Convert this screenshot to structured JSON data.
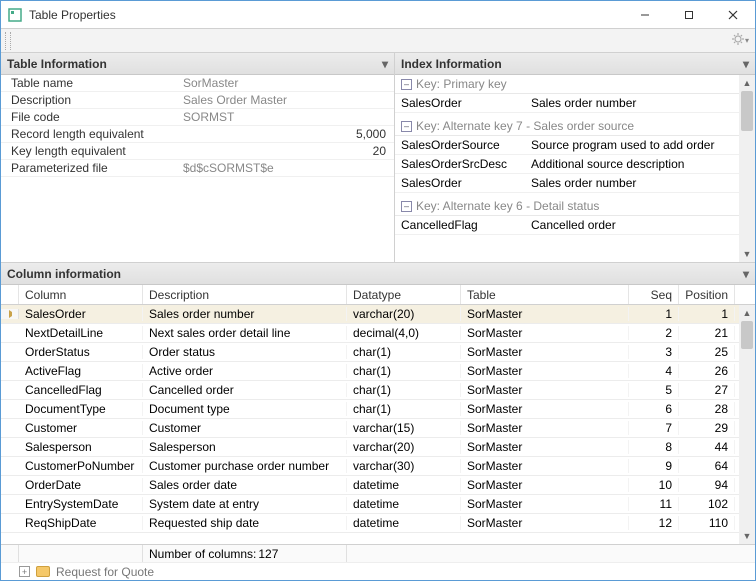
{
  "window": {
    "title": "Table Properties"
  },
  "panels": {
    "tableInfo": "Table Information",
    "indexInfo": "Index Information",
    "columnInfo": "Column information"
  },
  "tableInfo": {
    "rows": [
      {
        "label": "Table name",
        "value": "SorMaster",
        "readonly": true
      },
      {
        "label": "Description",
        "value": "Sales Order Master",
        "readonly": true
      },
      {
        "label": "File code",
        "value": "SORMST",
        "readonly": true
      },
      {
        "label": "Record length equivalent",
        "value": "5,000",
        "readonly": false,
        "numeric": true
      },
      {
        "label": "Key length equivalent",
        "value": "20",
        "readonly": false,
        "numeric": true
      },
      {
        "label": "Parameterized file",
        "value": "$d$cSORMST$e",
        "readonly": true
      }
    ]
  },
  "indexInfo": {
    "groups": [
      {
        "title": "Key: Primary key",
        "rows": [
          {
            "name": "SalesOrder",
            "desc": "Sales order number"
          }
        ]
      },
      {
        "title": "Key: Alternate key 7 - Sales order source",
        "rows": [
          {
            "name": "SalesOrderSource",
            "desc": "Source program used to add order"
          },
          {
            "name": "SalesOrderSrcDesc",
            "desc": "Additional source description"
          },
          {
            "name": "SalesOrder",
            "desc": "Sales order number"
          }
        ]
      },
      {
        "title": "Key: Alternate key 6 - Detail status",
        "rows": [
          {
            "name": "CancelledFlag",
            "desc": "Cancelled order"
          }
        ]
      }
    ]
  },
  "columns": {
    "headers": {
      "column": "Column",
      "description": "Description",
      "datatype": "Datatype",
      "table": "Table",
      "seq": "Seq",
      "position": "Position"
    },
    "rows": [
      {
        "column": "SalesOrder",
        "description": "Sales order number",
        "datatype": "varchar(20)",
        "table": "SorMaster",
        "seq": 1,
        "position": 1,
        "selected": true
      },
      {
        "column": "NextDetailLine",
        "description": "Next sales order detail line",
        "datatype": "decimal(4,0)",
        "table": "SorMaster",
        "seq": 2,
        "position": 21
      },
      {
        "column": "OrderStatus",
        "description": "Order status",
        "datatype": "char(1)",
        "table": "SorMaster",
        "seq": 3,
        "position": 25
      },
      {
        "column": "ActiveFlag",
        "description": "Active order",
        "datatype": "char(1)",
        "table": "SorMaster",
        "seq": 4,
        "position": 26
      },
      {
        "column": "CancelledFlag",
        "description": "Cancelled order",
        "datatype": "char(1)",
        "table": "SorMaster",
        "seq": 5,
        "position": 27
      },
      {
        "column": "DocumentType",
        "description": "Document type",
        "datatype": "char(1)",
        "table": "SorMaster",
        "seq": 6,
        "position": 28
      },
      {
        "column": "Customer",
        "description": "Customer",
        "datatype": "varchar(15)",
        "table": "SorMaster",
        "seq": 7,
        "position": 29
      },
      {
        "column": "Salesperson",
        "description": "Salesperson",
        "datatype": "varchar(20)",
        "table": "SorMaster",
        "seq": 8,
        "position": 44
      },
      {
        "column": "CustomerPoNumber",
        "description": "Customer purchase order number",
        "datatype": "varchar(30)",
        "table": "SorMaster",
        "seq": 9,
        "position": 64
      },
      {
        "column": "OrderDate",
        "description": "Sales order date",
        "datatype": "datetime",
        "table": "SorMaster",
        "seq": 10,
        "position": 94
      },
      {
        "column": "EntrySystemDate",
        "description": "System date at entry",
        "datatype": "datetime",
        "table": "SorMaster",
        "seq": 11,
        "position": 102
      },
      {
        "column": "ReqShipDate",
        "description": "Requested ship date",
        "datatype": "datetime",
        "table": "SorMaster",
        "seq": 12,
        "position": 110
      }
    ],
    "footer": {
      "label": "Number of columns:",
      "count": 127
    }
  },
  "bottomHint": {
    "text": "Request for Quote"
  }
}
